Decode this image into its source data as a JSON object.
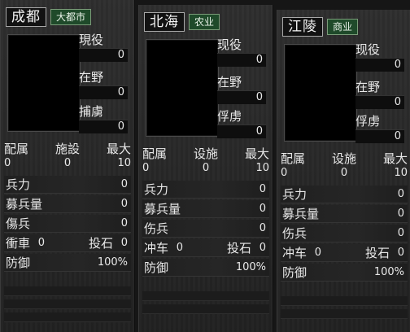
{
  "panels": [
    {
      "city": "成都",
      "tag": "大都市",
      "side": [
        {
          "label": "現役",
          "value": "0"
        },
        {
          "label": "在野",
          "value": "0"
        },
        {
          "label": "捕虜",
          "value": "0"
        }
      ],
      "trio": [
        {
          "label": "配属",
          "value": "0"
        },
        {
          "label": "施設",
          "value": "0"
        },
        {
          "label": "最大",
          "value": "10"
        }
      ],
      "rows": {
        "troops": {
          "label": "兵力",
          "value": "0"
        },
        "recruit": {
          "label": "募兵量",
          "value": "0"
        },
        "wounded": {
          "label": "傷兵",
          "value": "0"
        },
        "ram": {
          "label": "衝車",
          "value": "0"
        },
        "catapult": {
          "label": "投石",
          "value": "0"
        },
        "defense": {
          "label": "防御",
          "value": "100%"
        }
      }
    },
    {
      "city": "北海",
      "tag": "农业",
      "side": [
        {
          "label": "现役",
          "value": "0"
        },
        {
          "label": "在野",
          "value": "0"
        },
        {
          "label": "俘虏",
          "value": "0"
        }
      ],
      "trio": [
        {
          "label": "配属",
          "value": "0"
        },
        {
          "label": "设施",
          "value": "0"
        },
        {
          "label": "最大",
          "value": "10"
        }
      ],
      "rows": {
        "troops": {
          "label": "兵力",
          "value": "0"
        },
        "recruit": {
          "label": "募兵量",
          "value": "0"
        },
        "wounded": {
          "label": "伤兵",
          "value": "0"
        },
        "ram": {
          "label": "冲车",
          "value": "0"
        },
        "catapult": {
          "label": "投石",
          "value": "0"
        },
        "defense": {
          "label": "防御",
          "value": "100%"
        }
      }
    },
    {
      "city": "江陵",
      "tag": "商业",
      "side": [
        {
          "label": "现役",
          "value": "0"
        },
        {
          "label": "在野",
          "value": "0"
        },
        {
          "label": "俘虏",
          "value": "0"
        }
      ],
      "trio": [
        {
          "label": "配属",
          "value": "0"
        },
        {
          "label": "设施",
          "value": "0"
        },
        {
          "label": "最大",
          "value": "10"
        }
      ],
      "rows": {
        "troops": {
          "label": "兵力",
          "value": "0"
        },
        "recruit": {
          "label": "募兵量",
          "value": "0"
        },
        "wounded": {
          "label": "伤兵",
          "value": "0"
        },
        "ram": {
          "label": "冲车",
          "value": "0"
        },
        "catapult": {
          "label": "投石",
          "value": "0"
        },
        "defense": {
          "label": "防御",
          "value": "100%"
        }
      }
    }
  ],
  "colors": {
    "tag_bg": "#1f4a2a",
    "tag_border": "#7a9b78",
    "panel_bg": "#2b2b2b"
  }
}
